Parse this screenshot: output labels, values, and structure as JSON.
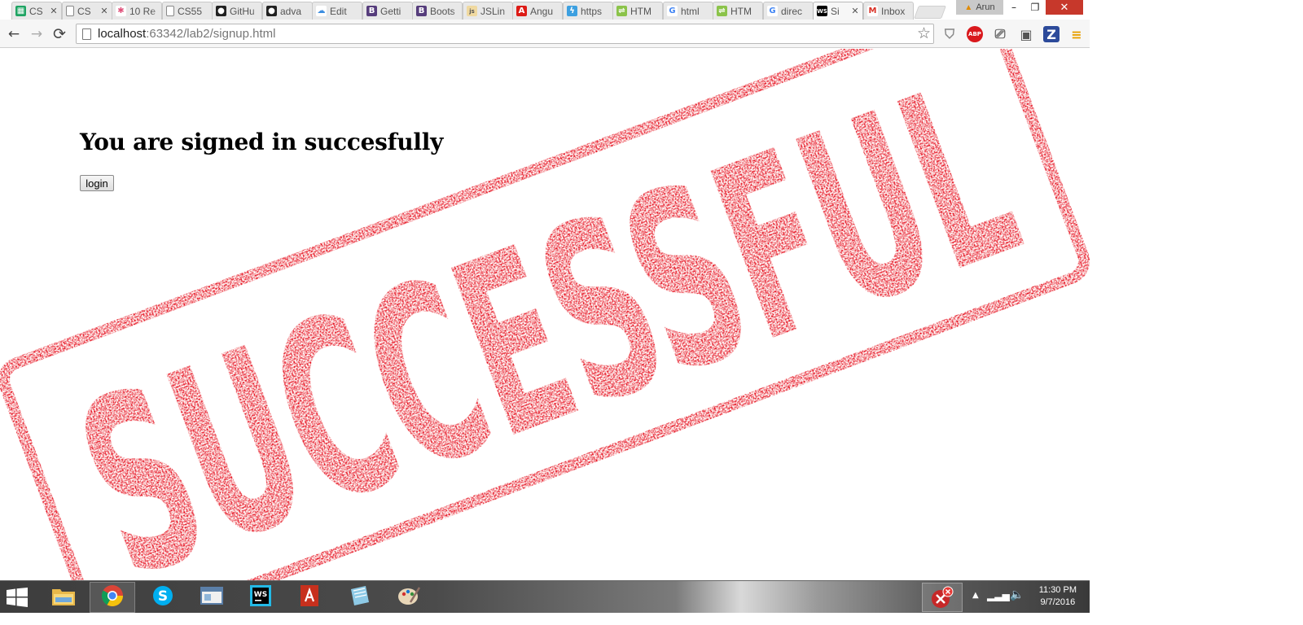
{
  "browser": {
    "tabs": [
      {
        "title": "CS",
        "icon": "spreadsheet-icon",
        "color": "#1fa463",
        "glyph": "▦",
        "closable": true
      },
      {
        "title": "CS",
        "icon": "document-icon",
        "color": "#ffffff",
        "glyph": "",
        "closable": true
      },
      {
        "title": "10 Re",
        "icon": "flower-icon",
        "color": "#ffffff",
        "glyph": "✱",
        "closable": false
      },
      {
        "title": "CS55",
        "icon": "document-icon",
        "color": "#ffffff",
        "glyph": "",
        "closable": false
      },
      {
        "title": "GitHu",
        "icon": "github-icon",
        "color": "#222222",
        "glyph": "●",
        "closable": false
      },
      {
        "title": "adva",
        "icon": "github-icon",
        "color": "#222222",
        "glyph": "●",
        "closable": false
      },
      {
        "title": "Edit",
        "icon": "cloud-icon",
        "color": "#ffffff",
        "glyph": "☁",
        "closable": false
      },
      {
        "title": "Getti",
        "icon": "bootstrap-icon",
        "color": "#563d7c",
        "glyph": "B",
        "closable": false
      },
      {
        "title": "Boots",
        "icon": "bootstrap-icon",
        "color": "#563d7c",
        "glyph": "B",
        "closable": false
      },
      {
        "title": "JSLin",
        "icon": "jslint-icon",
        "color": "#f0d9a0",
        "glyph": "js",
        "closable": false
      },
      {
        "title": "Angu",
        "icon": "angular-icon",
        "color": "#dd1b16",
        "glyph": "A",
        "closable": false
      },
      {
        "title": "https",
        "icon": "lightning-icon",
        "color": "#3da0e0",
        "glyph": "ϟ",
        "closable": false
      },
      {
        "title": "HTM",
        "icon": "html-icon",
        "color": "#8bc34a",
        "glyph": "⇌",
        "closable": false
      },
      {
        "title": "html",
        "icon": "google-icon",
        "color": "#ffffff",
        "glyph": "G",
        "closable": false
      },
      {
        "title": "HTM",
        "icon": "html-icon",
        "color": "#8bc34a",
        "glyph": "⇌",
        "closable": false
      },
      {
        "title": "direc",
        "icon": "google-icon",
        "color": "#ffffff",
        "glyph": "G",
        "closable": false
      },
      {
        "title": "Si",
        "icon": "webstorm-icon",
        "color": "#000000",
        "glyph": "WS",
        "closable": true,
        "active": true
      },
      {
        "title": "Inbox",
        "icon": "gmail-icon",
        "color": "#ffffff",
        "glyph": "M",
        "closable": false
      }
    ],
    "profile_name": "Arun",
    "window_controls": {
      "minimize": "–",
      "restore": "❐",
      "close": "✕"
    },
    "nav": {
      "back": "←",
      "forward": "→",
      "reload": "⟳"
    },
    "url_host": "localhost",
    "url_rest": ":63342/lab2/signup.html",
    "star": "☆",
    "extensions": [
      {
        "name": "shield-extension-icon",
        "glyph": "⛉",
        "bg": "transparent",
        "fg": "#888888"
      },
      {
        "name": "adblock-plus-icon",
        "glyph": "ABP",
        "bg": "#d9181c",
        "fg": "#ffffff"
      },
      {
        "name": "cast-icon",
        "glyph": "⎚",
        "bg": "transparent",
        "fg": "#666666"
      },
      {
        "name": "pocket-extension-icon",
        "glyph": "▣",
        "bg": "transparent",
        "fg": "#555555"
      },
      {
        "name": "zotero-extension-icon",
        "glyph": "Z",
        "bg": "#2c4a9a",
        "fg": "#ffffff"
      },
      {
        "name": "menu-icon",
        "glyph": "≡",
        "bg": "transparent",
        "fg": "#e8a000"
      }
    ]
  },
  "page": {
    "heading": "You are signed in succesfully",
    "login_button": "login",
    "stamp_text": "SUCCESSFUL",
    "stamp_color": "#e4000f"
  },
  "taskbar": {
    "apps": [
      {
        "name": "taskbar-file-explorer",
        "icon": "folder-icon",
        "open": false
      },
      {
        "name": "taskbar-chrome",
        "icon": "chrome-icon",
        "open": true
      },
      {
        "name": "taskbar-skype",
        "icon": "skype-icon",
        "open": false
      },
      {
        "name": "taskbar-window-app",
        "icon": "window-icon",
        "open": false
      },
      {
        "name": "taskbar-webstorm",
        "icon": "webstorm-icon",
        "open": false
      },
      {
        "name": "taskbar-acrobat",
        "icon": "acrobat-icon",
        "open": false
      },
      {
        "name": "taskbar-notepad",
        "icon": "notepad-icon",
        "open": false
      },
      {
        "name": "taskbar-paint",
        "icon": "paint-icon",
        "open": false
      }
    ],
    "time": "11:30 PM",
    "date": "9/7/2016"
  }
}
